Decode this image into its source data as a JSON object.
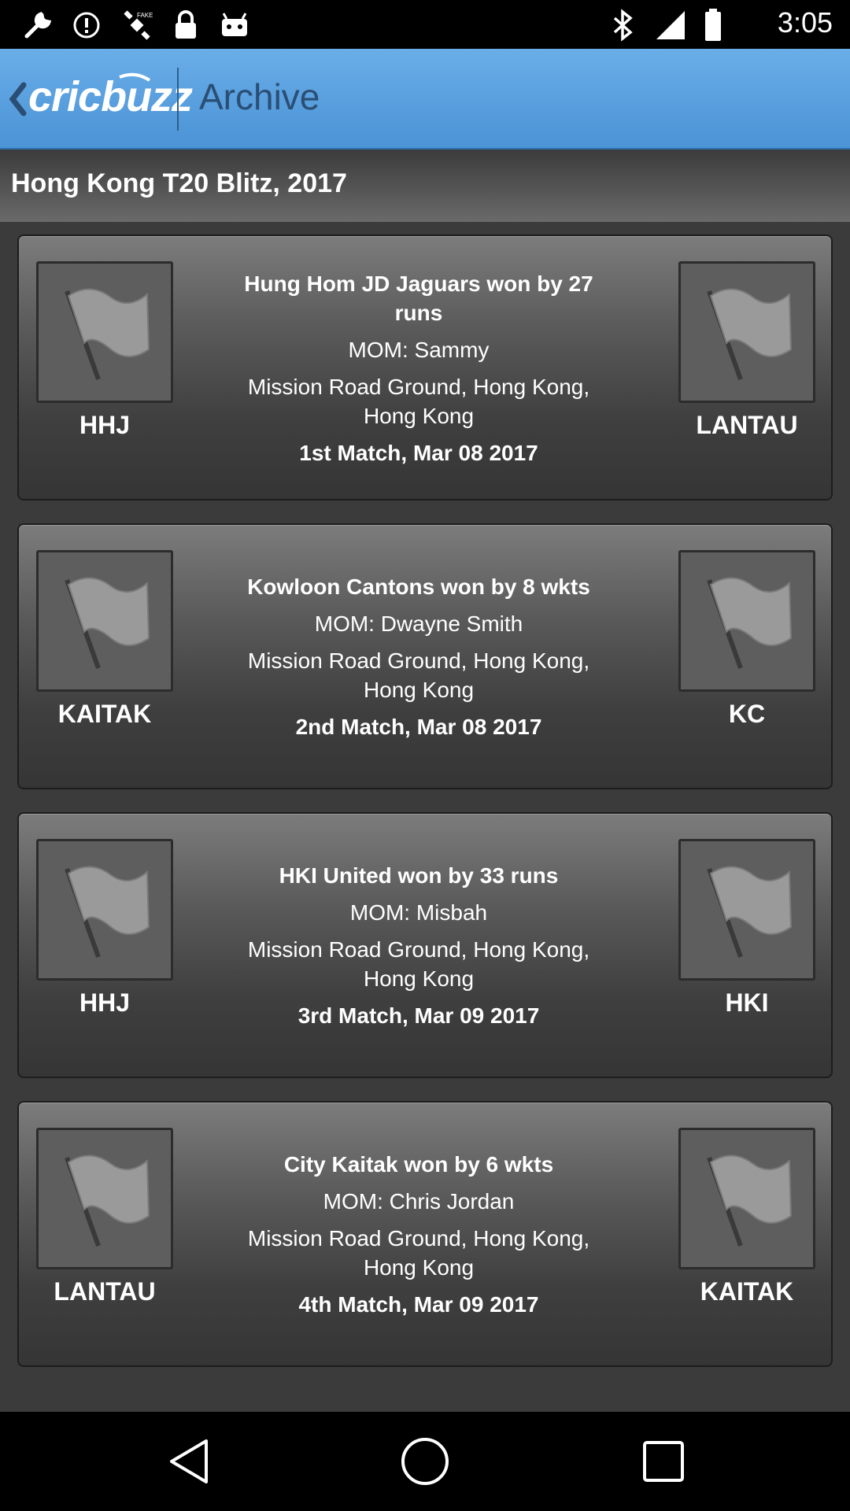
{
  "status_bar": {
    "time": "3:05",
    "icons": [
      "wrench-icon",
      "alert-icon",
      "fake-gps-icon",
      "lock-icon",
      "android-icon",
      "bluetooth-icon",
      "signal-icon",
      "battery-icon"
    ]
  },
  "header": {
    "logo_text": "cricbuzz",
    "title": "Archive",
    "accent_color": "#4b93d6"
  },
  "section": {
    "title": "Hong Kong T20 Blitz, 2017"
  },
  "matches": [
    {
      "team_left": "HHJ",
      "team_right": "LANTAU",
      "result": "Hung Hom JD Jaguars won by 27 runs",
      "mom": "MOM: Sammy",
      "venue": "Mission Road Ground, Hong Kong, Hong Kong",
      "match": "1st Match, Mar 08 2017"
    },
    {
      "team_left": "KAITAK",
      "team_right": "KC",
      "result": "Kowloon Cantons won by 8 wkts",
      "mom": "MOM: Dwayne Smith",
      "venue": "Mission Road Ground, Hong Kong, Hong Kong",
      "match": "2nd Match, Mar 08 2017"
    },
    {
      "team_left": "HHJ",
      "team_right": "HKI",
      "result": "HKI United won by 33 runs",
      "mom": "MOM: Misbah",
      "venue": "Mission Road Ground, Hong Kong, Hong Kong",
      "match": "3rd Match, Mar 09 2017"
    },
    {
      "team_left": "LANTAU",
      "team_right": "KAITAK",
      "result": "City Kaitak won by 6 wkts",
      "mom": "MOM: Chris Jordan",
      "venue": "Mission Road Ground, Hong Kong, Hong Kong",
      "match": "4th Match, Mar 09 2017"
    }
  ],
  "nav": {
    "icons": [
      "back-icon",
      "home-icon",
      "recents-icon"
    ]
  }
}
